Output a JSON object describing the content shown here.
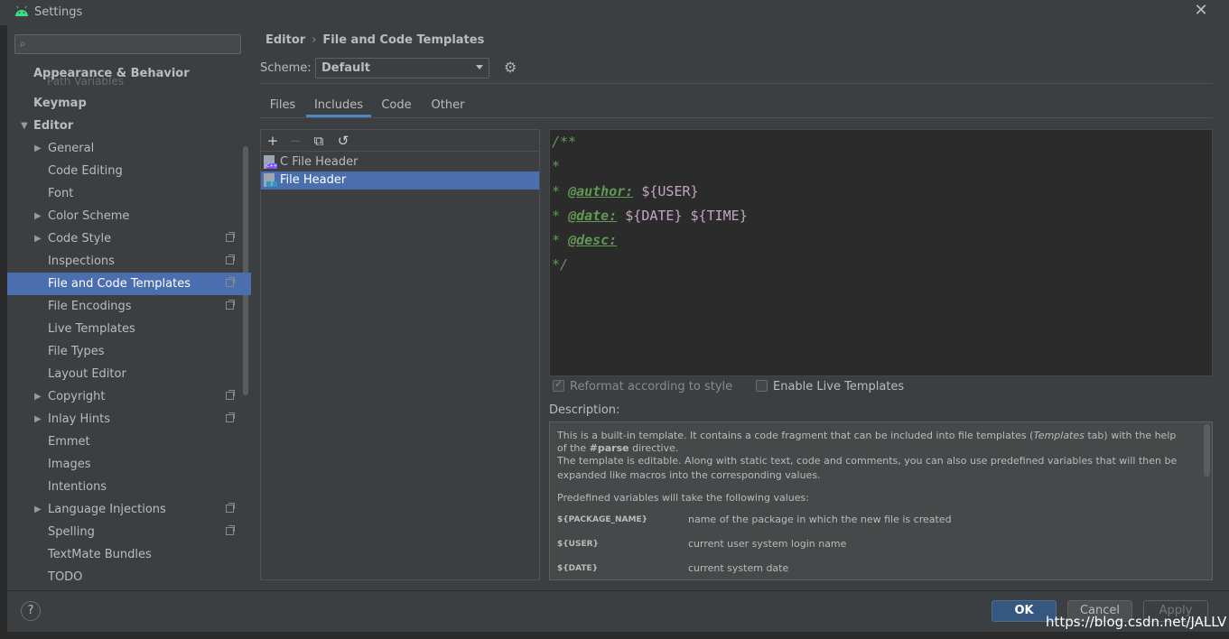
{
  "window": {
    "title": "Settings",
    "close_glyph": "✕"
  },
  "sidebar": {
    "search_placeholder": "",
    "ghost_text": "Path Variables",
    "items": [
      {
        "label": "Appearance & Behavior"
      },
      {
        "label": "Keymap"
      },
      {
        "label": "Editor"
      },
      {
        "label": "General"
      },
      {
        "label": "Code Editing"
      },
      {
        "label": "Font"
      },
      {
        "label": "Color Scheme"
      },
      {
        "label": "Code Style"
      },
      {
        "label": "Inspections"
      },
      {
        "label": "File and Code Templates"
      },
      {
        "label": "File Encodings"
      },
      {
        "label": "Live Templates"
      },
      {
        "label": "File Types"
      },
      {
        "label": "Layout Editor"
      },
      {
        "label": "Copyright"
      },
      {
        "label": "Inlay Hints"
      },
      {
        "label": "Emmet"
      },
      {
        "label": "Images"
      },
      {
        "label": "Intentions"
      },
      {
        "label": "Language Injections"
      },
      {
        "label": "Spelling"
      },
      {
        "label": "TextMate Bundles"
      },
      {
        "label": "TODO"
      }
    ]
  },
  "breadcrumb": {
    "parent": "Editor",
    "sep": "›",
    "current": "File and Code Templates"
  },
  "scheme": {
    "label": "Scheme:",
    "value": "Default"
  },
  "tabs": [
    {
      "label": "Files"
    },
    {
      "label": "Includes"
    },
    {
      "label": "Code"
    },
    {
      "label": "Other"
    }
  ],
  "toolbar": {
    "add": "+",
    "remove": "−",
    "copy": "⧉",
    "reset": "↺"
  },
  "templates": [
    {
      "name": "C File Header",
      "tag": "C++"
    },
    {
      "name": "File Header",
      "tag": "J"
    }
  ],
  "editor": {
    "lines": [
      {
        "a": "/**"
      },
      {
        "a": "*"
      },
      {
        "a": "* ",
        "tag": "@author:",
        "var": " ${USER}"
      },
      {
        "a": "* ",
        "tag": "@date:",
        "var": " ${DATE} ${TIME}"
      },
      {
        "a": "* ",
        "tag": "@desc:"
      },
      {
        "a": "*/"
      }
    ]
  },
  "options": {
    "reformat": "Reformat according to style",
    "live": "Enable Live Templates"
  },
  "description": {
    "label": "Description:",
    "p1a": "This is a built-in template. It contains a code fragment that can be included into file templates (",
    "p1b": "Templates",
    "p1c": " tab) with the help",
    "p2a": "of the ",
    "p2b": "#parse",
    "p2c": " directive.",
    "p3": "The template is editable. Along with static text, code and comments, you can also use predefined variables that will then be",
    "p4": "expanded like macros into the corresponding values.",
    "p5": "Predefined variables will take the following values:",
    "vars": [
      {
        "name": "${PACKAGE_NAME}",
        "desc": "name of the package in which the new file is created"
      },
      {
        "name": "${USER}",
        "desc": "current user system login name"
      },
      {
        "name": "${DATE}",
        "desc": "current system date"
      }
    ]
  },
  "buttons": {
    "help": "?",
    "ok": "OK",
    "cancel": "Cancel",
    "apply": "Apply"
  },
  "watermark": "https://blog.csdn.net/JALLV",
  "colors": {
    "selection": "#4b6eaf",
    "panel": "#3c3f41",
    "editor_bg": "#2b2b2b",
    "doc_green": "#629755",
    "var_purple": "#c5a5c5"
  }
}
